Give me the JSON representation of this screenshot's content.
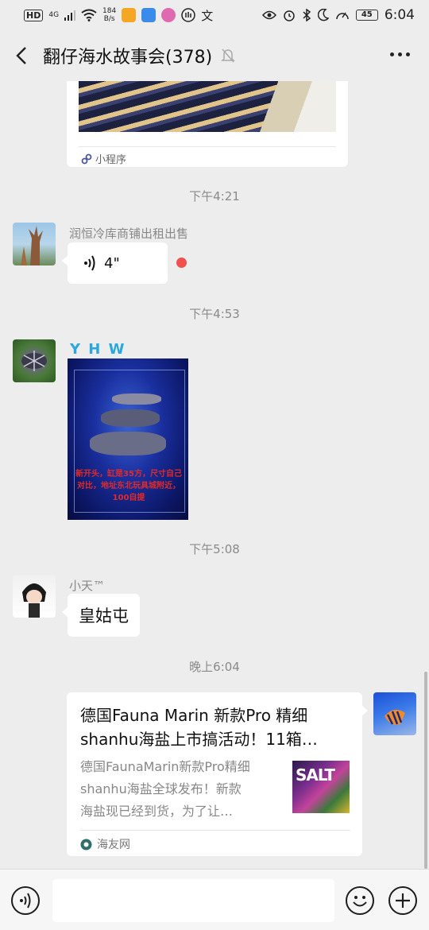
{
  "status_bar": {
    "hd": "HD",
    "network": "4G",
    "speed_value": "184",
    "speed_unit": "B/s",
    "battery": "45",
    "time": "6:04",
    "colors": {
      "app1": "#f5a623",
      "app2": "#3b8beb",
      "app3": "#e06ab0"
    }
  },
  "header": {
    "title": "翻仔海水故事会(378)",
    "icons": {
      "back": "chevron-left-icon",
      "mute": "bell-off-icon",
      "more": "more-dots-icon"
    }
  },
  "messages": {
    "mini_program_label": "小程序",
    "timestamp_1": "下午4:21",
    "voice_sender": "润恒冷库商铺出租出售",
    "voice_duration": "4\"",
    "timestamp_2": "下午4:53",
    "photo_sender": "Y H W",
    "photo_caption": "新开头，缸是35方，尺寸自己对比，地址东北玩具城附近，100自提",
    "timestamp_3": "下午5:08",
    "text_sender": "小天™",
    "text_body": "皇姑屯",
    "timestamp_4": "晚上6:04",
    "link_title": "德国Fauna Marin 新款Pro 精细\nshanhu海盐上市搞活动！11箱…",
    "link_description": "德国FaunaMarin新款Pro精细\nshanhu海盐全球发布！新款\n海盐现已经到货，为了让…",
    "link_thumb_text": "SALT",
    "link_source": "海友网"
  },
  "input_bar": {
    "icons": {
      "voice": "voice-mode-icon",
      "emoji": "emoji-icon",
      "plus": "plus-icon"
    }
  },
  "colors": {
    "background": "#ededed",
    "bubble": "#ffffff",
    "unread_dot": "#f05050",
    "sender_yhw": "#29a8df"
  }
}
